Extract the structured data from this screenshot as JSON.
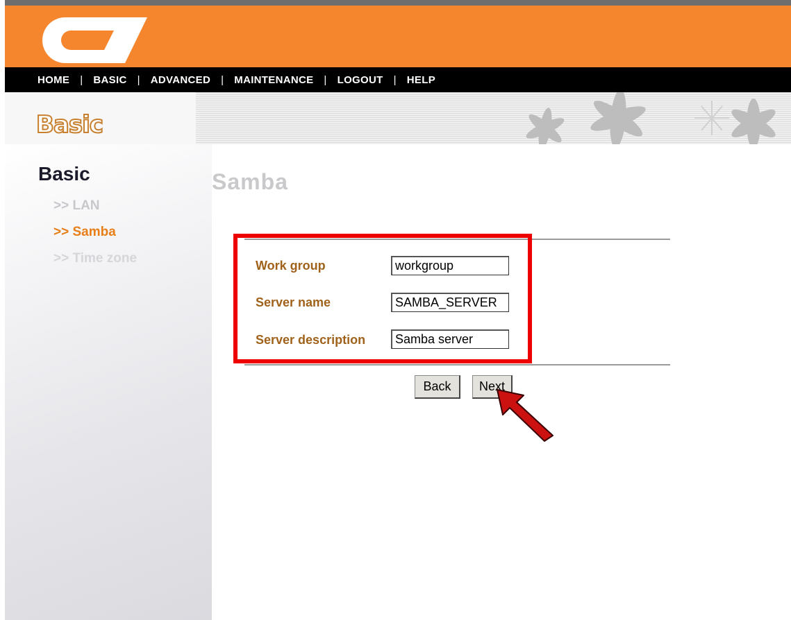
{
  "nav": {
    "items": [
      "HOME",
      "BASIC",
      "ADVANCED",
      "MAINTENANCE",
      "LOGOUT",
      "HELP"
    ],
    "separator": "|"
  },
  "banner": {
    "title": "Basic"
  },
  "sidebar": {
    "heading": "Basic",
    "items": [
      ">> LAN",
      ">> Samba",
      ">> Time zone"
    ],
    "active_item": ">> Samba"
  },
  "page": {
    "title": "Samba",
    "form": {
      "work_group": {
        "label": "Work group",
        "value": "workgroup"
      },
      "server_name": {
        "label": "Server name",
        "value": "SAMBA_SERVER"
      },
      "server_description": {
        "label": "Server description",
        "value": "Samba server"
      }
    },
    "buttons": {
      "back": "Back",
      "next": "Next"
    }
  },
  "colors": {
    "header": "#f6862e",
    "navbar": "#000000",
    "label": "#a0621a",
    "active_sidebar": "#e87e18",
    "highlight_box": "#ee0000",
    "arrow": "#cc1111"
  },
  "icons": [
    "logo-icon",
    "flower-decoration-icon",
    "pointer-arrow-icon"
  ]
}
